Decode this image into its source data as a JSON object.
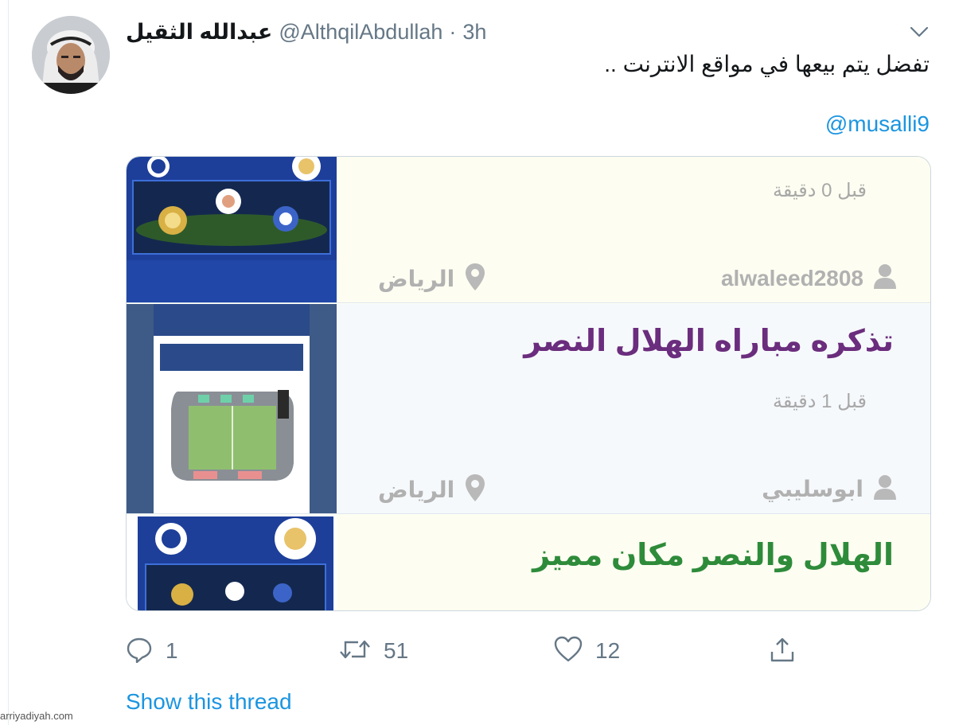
{
  "tweet": {
    "display_name": "عبدالله الثقيل",
    "handle": "@AlthqilAbdullah",
    "separator": "·",
    "time": "3h",
    "text": "تفضل يتم بيعها في مواقع الانترنت ..",
    "mention": "@musalli9"
  },
  "card": {
    "listings": [
      {
        "title": "",
        "ago": "قبل 0 دقيقة",
        "user": "alwaleed2808",
        "location": "الرياض"
      },
      {
        "title": "تذكره مباراه الهلال  النصر",
        "ago": "قبل 1 دقيقة",
        "user": "ابوسليبي",
        "location": "الرياض"
      },
      {
        "title": "الهلال والنصر مكان مميز"
      }
    ]
  },
  "actions": {
    "replies": "1",
    "retweets": "51",
    "likes": "12"
  },
  "show_thread": "Show this thread",
  "watermark": "arriyadiyah.com",
  "colors": {
    "link": "#1b95e0",
    "muted": "#657786",
    "title_purple": "#6b2d7d",
    "title_green": "#2e8b3a"
  },
  "icons": [
    "chevron-down-icon",
    "user-icon",
    "location-pin-icon",
    "reply-icon",
    "retweet-icon",
    "like-icon",
    "share-icon"
  ]
}
